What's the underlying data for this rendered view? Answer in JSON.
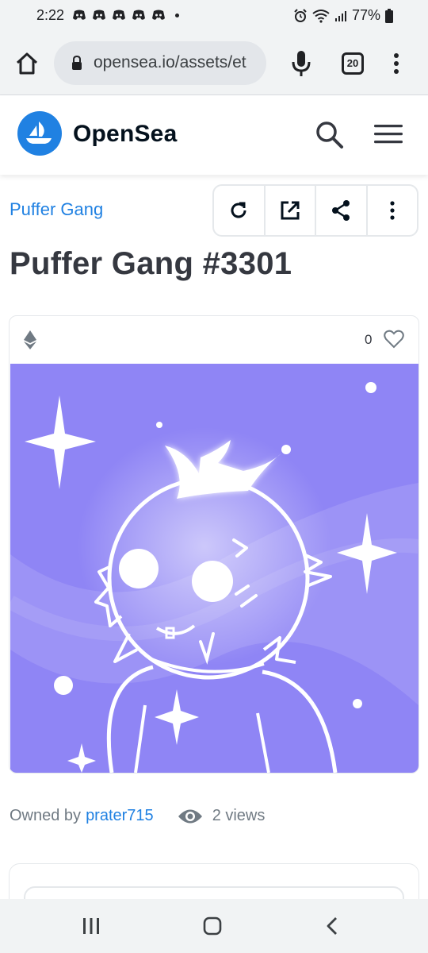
{
  "status_bar": {
    "time": "2:22",
    "battery": "77%",
    "notification_icons": [
      "discord-icon",
      "discord-icon",
      "discord-icon",
      "discord-icon",
      "discord-icon"
    ]
  },
  "browser": {
    "url": "opensea.io/assets/et",
    "tab_count": "20"
  },
  "header": {
    "brand": "OpenSea"
  },
  "asset": {
    "collection": "Puffer Gang",
    "title": "Puffer Gang #3301",
    "favorites": "0",
    "owned_by_label": "Owned by",
    "owner": "prater715",
    "views": "2 views"
  },
  "colors": {
    "accent": "#2081e2",
    "image_bg": "#8f85f5",
    "text_dark": "#353840",
    "text_muted": "#707a83"
  }
}
